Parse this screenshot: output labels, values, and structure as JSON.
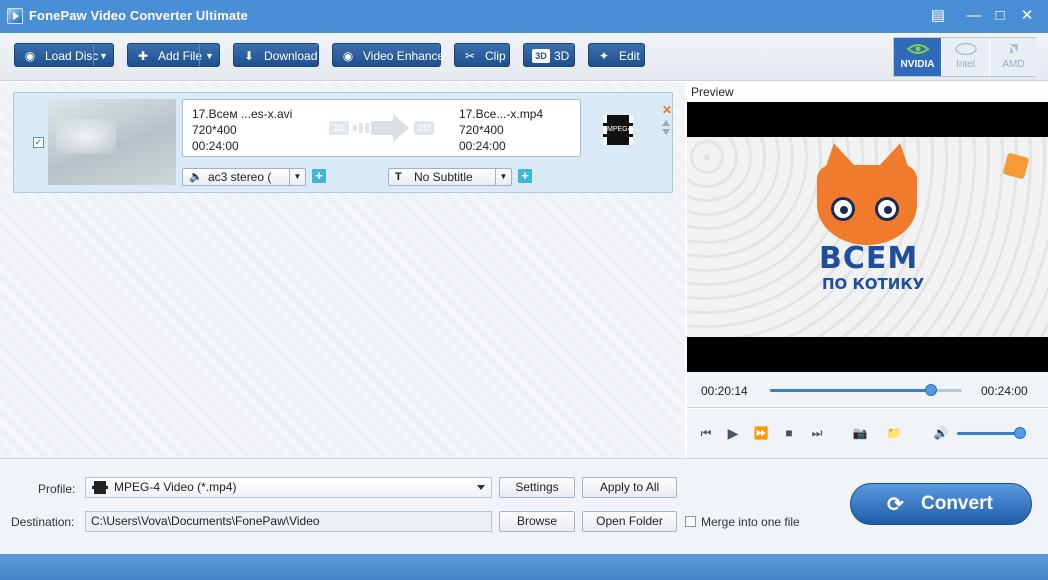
{
  "window": {
    "title": "FonePaw Video Converter Ultimate"
  },
  "toolbar": {
    "load_disc": "Load Disc",
    "add_file": "Add File",
    "download": "Download",
    "video_enhance": "Video Enhance",
    "clip": "Clip",
    "three_d": "3D",
    "edit": "Edit",
    "gpu": {
      "nvidia": "NVIDIA",
      "intel": "Intel",
      "amd": "AMD"
    }
  },
  "file_item": {
    "checked": true,
    "source": {
      "name": "17.Всем ...es-x.avi",
      "resolution": "720*400",
      "duration": "00:24:00",
      "badge": "2D"
    },
    "output": {
      "name": "17.Все...-x.mp4",
      "resolution": "720*400",
      "duration": "00:24:00",
      "badge": "2D"
    },
    "format_icon": "MPEG4",
    "audio_track": "ac3 stereo (",
    "subtitle": "No Subtitle"
  },
  "preview": {
    "label": "Preview",
    "logo_line1": "ВСЕМ",
    "logo_line2": "ПО КОТИКУ",
    "current_time": "00:20:14",
    "total_time": "00:24:00",
    "progress_fraction": 0.84,
    "volume_fraction": 0.95
  },
  "bottom": {
    "profile_label": "Profile:",
    "profile_value": "MPEG-4 Video (*.mp4)",
    "settings": "Settings",
    "apply_to_all": "Apply to All",
    "destination_label": "Destination:",
    "destination_value": "C:\\Users\\Vova\\Documents\\FonePaw\\Video",
    "browse": "Browse",
    "open_folder": "Open Folder",
    "merge_label": "Merge into one file",
    "merge_checked": false,
    "convert": "Convert"
  },
  "colors": {
    "titlebar": "#4a8ed6",
    "toolbar_button": "#2a5c9c",
    "accent": "#3a7dc6",
    "nvidia_active": "#2f6bb8"
  }
}
